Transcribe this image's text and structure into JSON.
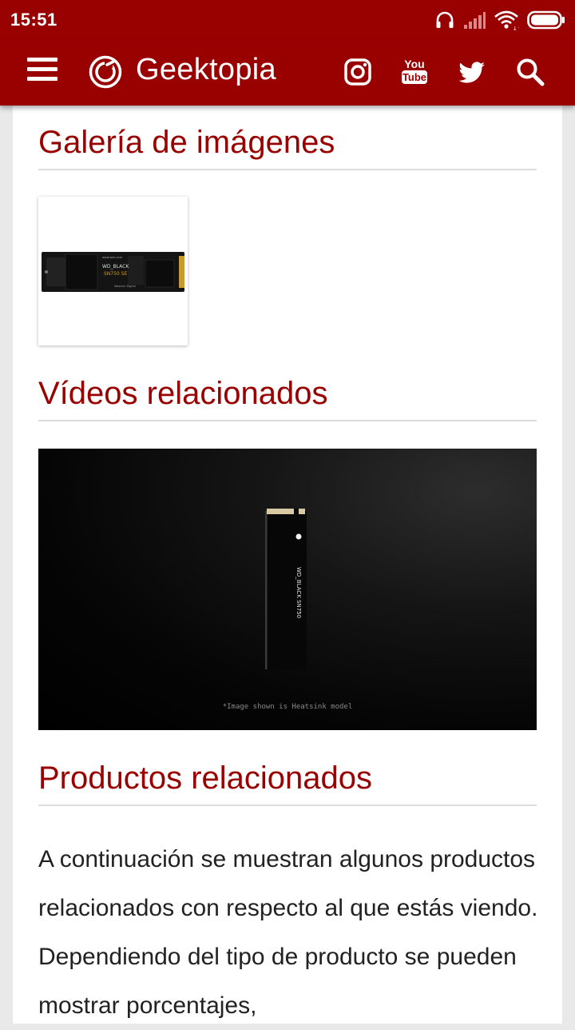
{
  "status_bar": {
    "time": "15:51",
    "icons": [
      "headphones-icon",
      "signal-icon",
      "wifi-icon",
      "battery-icon"
    ]
  },
  "app_bar": {
    "brand": "Geektopia",
    "icons": [
      "menu-icon",
      "geektopia-logo-icon",
      "instagram-icon",
      "youtube-icon",
      "twitter-icon",
      "search-icon"
    ],
    "youtube_you": "You",
    "youtube_tube": "Tube"
  },
  "colors": {
    "brand_red": "#990000",
    "title_red": "#990000",
    "text": "#222222"
  },
  "content": {
    "gallery_title": "Galería de imágenes",
    "gallery_image": {
      "brand_text": "WD_BLACK",
      "model_text": "SN750 SE"
    },
    "videos_title": "Vídeos relacionados",
    "video": {
      "ssd_label": "WD_BLACK SN750",
      "caption": "*Image shown is Heatsink model"
    },
    "products_title": "Productos relacionados",
    "products_text": "A continuación se muestran algunos productos relacionados con respecto al que estás viendo. Dependiendo del tipo de producto se pueden mostrar porcentajes,"
  }
}
